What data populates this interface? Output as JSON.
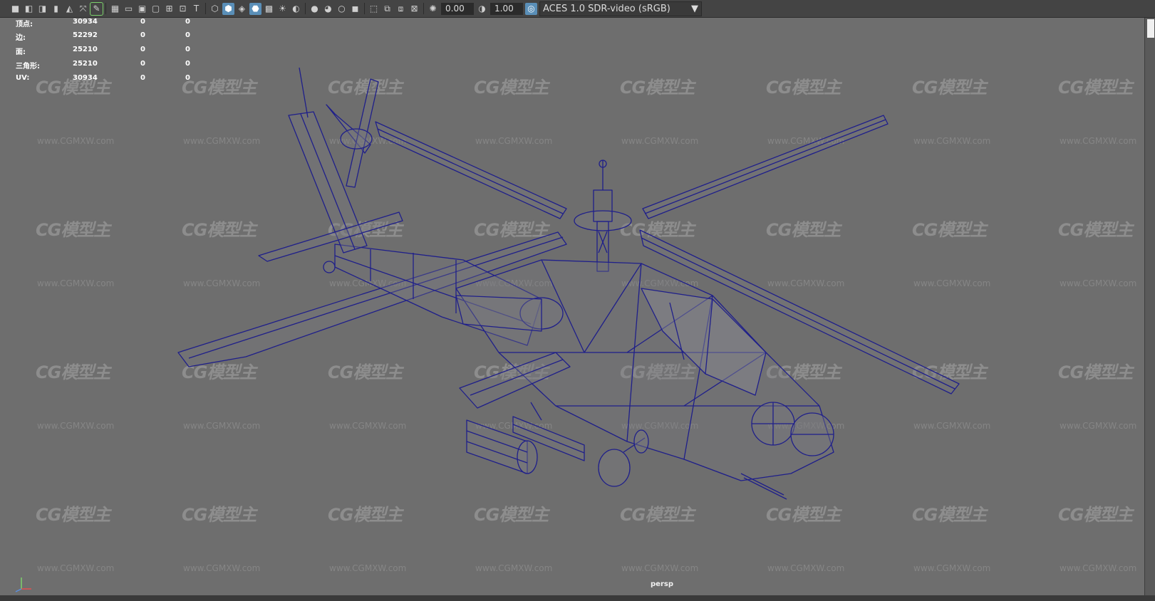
{
  "toolbar": {
    "exposure_value": "0.00",
    "gamma_value": "1.00",
    "color_space": "ACES 1.0 SDR-video (sRGB)",
    "icons": [
      "camera-icon",
      "camera-lock-icon",
      "camera-attr-icon",
      "bookmark-icon",
      "image-plane-icon",
      "2d-pan-icon",
      "grease-pencil-icon",
      "grid-icon",
      "film-gate-icon",
      "resolution-gate-icon",
      "gate-mask-icon",
      "field-chart-icon",
      "safe-action-icon",
      "safe-title-icon",
      "wireframe-icon",
      "smooth-shade-icon",
      "flat-shade-icon",
      "wireframe-on-shaded-icon",
      "textured-icon",
      "lighting-icon",
      "shadows-icon",
      "ambient-occlusion-icon",
      "motion-blur-icon",
      "anti-alias-icon",
      "isolate-select-icon",
      "xray-icon",
      "xray-joints-icon",
      "xray-components-icon",
      "exposure-icon",
      "gamma-icon",
      "color-management-icon"
    ]
  },
  "hud": {
    "rows": [
      {
        "label": "顶点:",
        "a": "30934",
        "b": "0",
        "c": "0"
      },
      {
        "label": "边:",
        "a": "52292",
        "b": "0",
        "c": "0"
      },
      {
        "label": "面:",
        "a": "25210",
        "b": "0",
        "c": "0"
      },
      {
        "label": "三角形:",
        "a": "25210",
        "b": "0",
        "c": "0"
      },
      {
        "label": "UV:",
        "a": "30934",
        "b": "0",
        "c": "0"
      }
    ]
  },
  "watermark": {
    "logo": "CG模型主",
    "url": "www.CGMXW.com"
  },
  "viewport": {
    "camera": "persp"
  },
  "colors": {
    "wire": "#1f1f8a",
    "viewport_bg": "#6e6e6e",
    "toolbar_bg": "#444444"
  }
}
